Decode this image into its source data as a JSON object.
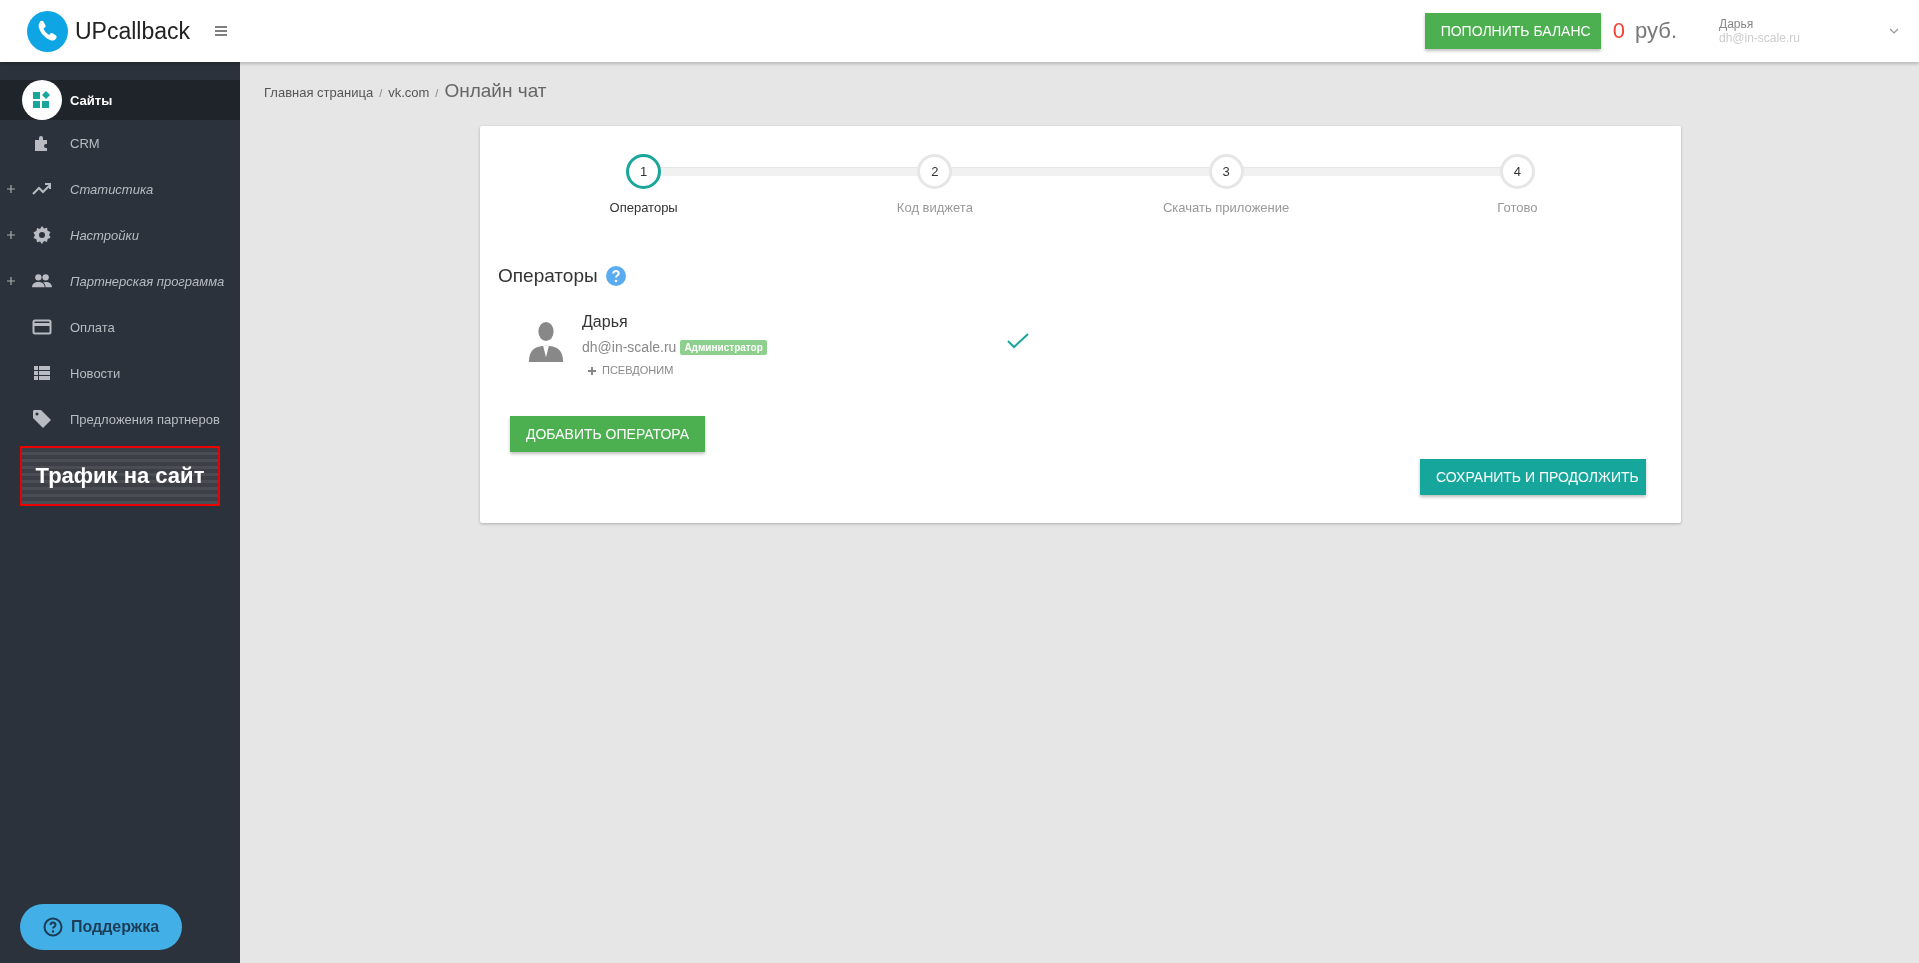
{
  "header": {
    "brand": "UPcallback",
    "topup_button": "ПОПОЛНИТЬ БАЛАНС",
    "balance_amount": "0",
    "balance_currency": "руб.",
    "user_name": "Дарья",
    "user_email": "dh@in-scale.ru"
  },
  "sidebar": {
    "items": [
      {
        "label": "Сайты",
        "selected": true,
        "expandable": false
      },
      {
        "label": "CRM",
        "selected": false,
        "expandable": false
      },
      {
        "label": "Статистика",
        "selected": false,
        "expandable": true
      },
      {
        "label": "Настройки",
        "selected": false,
        "expandable": true
      },
      {
        "label": "Партнерская программа",
        "selected": false,
        "expandable": true
      },
      {
        "label": "Оплата",
        "selected": false,
        "expandable": false
      },
      {
        "label": "Новости",
        "selected": false,
        "expandable": false
      },
      {
        "label": "Предложения партнеров",
        "selected": false,
        "expandable": false
      }
    ],
    "banner": "Трафик на сайт",
    "support_button": "Поддержка"
  },
  "breadcrumb": [
    {
      "text": "Главная страница"
    },
    {
      "separator": "/",
      "text": "vk.com"
    },
    {
      "separator": "/",
      "text": "Онлайн чат"
    }
  ],
  "stepper": [
    {
      "number": "1",
      "label": "Операторы",
      "selected": true
    },
    {
      "number": "2",
      "label": "Код виджета",
      "selected": false
    },
    {
      "number": "3",
      "label": "Скачать приложение",
      "selected": false
    },
    {
      "number": "4",
      "label": "Готово",
      "selected": false
    }
  ],
  "section_title": "Операторы",
  "operators": [
    {
      "name": "Дарья",
      "email": "dh@in-scale.ru",
      "role": "Администратор",
      "alias_link": "ПСЕВДОНИМ",
      "active": true
    }
  ],
  "add_button": "ДОБАВИТЬ ОПЕРАТОРА",
  "save_button": "СОХРАНИТЬ И ПРОДОЛЖИТЬ"
}
